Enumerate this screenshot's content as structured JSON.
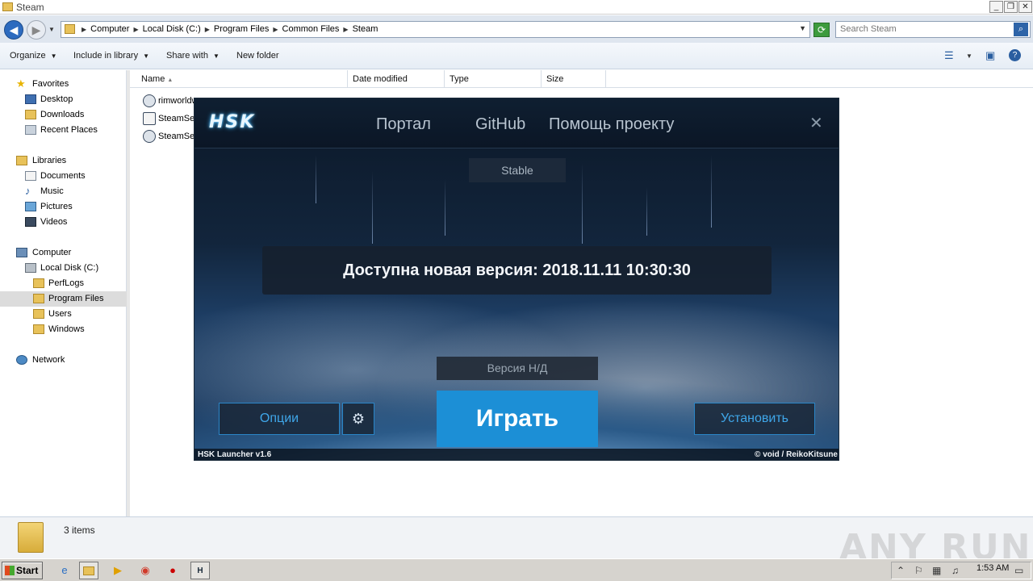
{
  "window": {
    "title": "Steam"
  },
  "address": {
    "crumbs": [
      "Computer",
      "Local Disk (C:)",
      "Program Files",
      "Common Files",
      "Steam"
    ]
  },
  "search": {
    "placeholder": "Search Steam"
  },
  "toolbar": {
    "organize": "Organize",
    "include": "Include in library",
    "share": "Share with",
    "newfolder": "New folder"
  },
  "nav": {
    "favorites": "Favorites",
    "desktop": "Desktop",
    "downloads": "Downloads",
    "recent": "Recent Places",
    "libraries": "Libraries",
    "documents": "Documents",
    "music": "Music",
    "pictures": "Pictures",
    "videos": "Videos",
    "computer": "Computer",
    "localdisk": "Local Disk (C:)",
    "perflogs": "PerfLogs",
    "programfiles": "Program Files",
    "users": "Users",
    "windows": "Windows",
    "network": "Network"
  },
  "columns": {
    "name": "Name",
    "date": "Date modified",
    "type": "Type",
    "size": "Size"
  },
  "files": [
    {
      "name": "rimworldw"
    },
    {
      "name": "SteamSer"
    },
    {
      "name": "SteamSer"
    }
  ],
  "status": {
    "items": "3 items",
    "watermark": "ANY RUN"
  },
  "taskbar": {
    "start": "Start",
    "clock": "1:53 AM"
  },
  "launcher": {
    "logo": "HSK",
    "nav": {
      "portal": "Портал",
      "github": "GitHub",
      "help": "Помощь проекту"
    },
    "close": "✕",
    "channel": "Stable",
    "banner": "Доступна новая версия: 2018.11.11 10:30:30",
    "version": "Версия Н/Д",
    "play": "Играть",
    "options": "Опции",
    "install": "Установить",
    "footer_left": "HSK Launcher v1.6",
    "footer_right": "© void / ReikoKitsune"
  }
}
